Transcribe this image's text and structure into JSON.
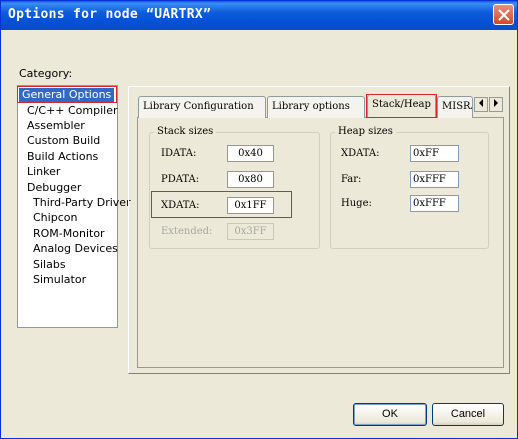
{
  "window": {
    "title": "Options for node “UARTRX”"
  },
  "category": {
    "label": "Category:",
    "items": [
      {
        "label": "General Options",
        "selected": true
      },
      {
        "label": "C/C++ Compiler"
      },
      {
        "label": "Assembler"
      },
      {
        "label": "Custom Build"
      },
      {
        "label": "Build Actions"
      },
      {
        "label": "Linker"
      },
      {
        "label": "Debugger"
      },
      {
        "label": "Third-Party Driver"
      },
      {
        "label": "Chipcon"
      },
      {
        "label": "ROM-Monitor"
      },
      {
        "label": "Analog Devices"
      },
      {
        "label": "Silabs"
      },
      {
        "label": "Simulator"
      }
    ]
  },
  "tabs": [
    {
      "label": "Library Configuration"
    },
    {
      "label": "Library options"
    },
    {
      "label": "Stack/Heap",
      "active": true
    },
    {
      "label": "MISRA"
    }
  ],
  "stack_sizes": {
    "title": "Stack sizes",
    "fields": [
      {
        "label": "IDATA:",
        "value": "0x40"
      },
      {
        "label": "PDATA:",
        "value": "0x80"
      },
      {
        "label": "XDATA:",
        "value": "0x1FF"
      },
      {
        "label": "Extended:",
        "value": "0x3FF",
        "disabled": true
      }
    ]
  },
  "heap_sizes": {
    "title": "Heap sizes",
    "fields": [
      {
        "label": "XDATA:",
        "value": "0xFF"
      },
      {
        "label": "Far:",
        "value": "0xFFF"
      },
      {
        "label": "Huge:",
        "value": "0xFFF"
      }
    ]
  },
  "buttons": {
    "ok": "OK",
    "cancel": "Cancel"
  },
  "colors": {
    "title_bar": "#0b5ddc",
    "selection": "#316ac5",
    "highlight_box": "#d8262e"
  }
}
